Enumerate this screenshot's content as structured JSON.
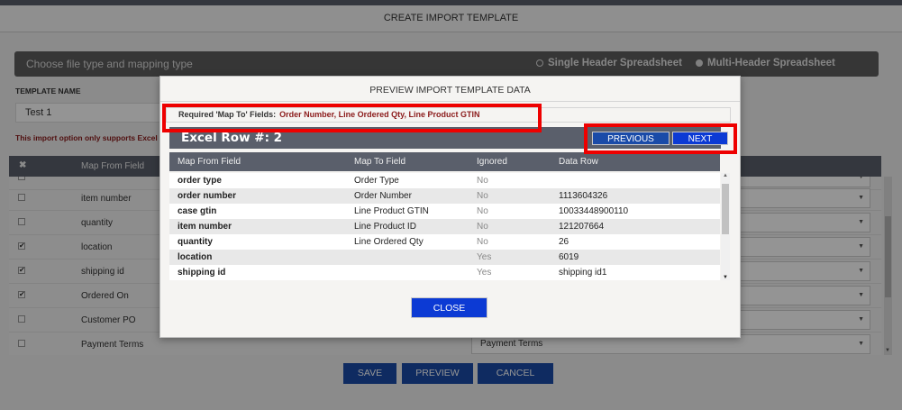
{
  "page": {
    "title": "CREATE IMPORT TEMPLATE",
    "file_type_label": "Choose file type and mapping type",
    "option_single": "Single Header Spreadsheet",
    "option_multi": "Multi-Header Spreadsheet",
    "template_name_label": "TEMPLATE NAME",
    "template_name_value": "Test 1",
    "warning": "This import option only supports Excel",
    "map_header_x": "✖",
    "map_header_from": "Map From Field",
    "rows": [
      {
        "checked": "",
        "field": "item number",
        "select": ""
      },
      {
        "checked": "",
        "field": "quantity",
        "select": ""
      },
      {
        "checked": "✔",
        "field": "location",
        "select": ""
      },
      {
        "checked": "✔",
        "field": "shipping id",
        "select": ""
      },
      {
        "checked": "✔",
        "field": "Ordered On",
        "select": ""
      },
      {
        "checked": "",
        "field": "Customer PO",
        "select": ""
      },
      {
        "checked": "",
        "field": "Payment Terms",
        "select": "Payment Terms"
      }
    ],
    "buttons": {
      "save": "SAVE",
      "preview": "PREVIEW",
      "cancel": "CANCEL"
    }
  },
  "modal": {
    "title": "PREVIEW IMPORT TEMPLATE DATA",
    "required_label": "Required 'Map To' Fields:",
    "required_value": "Order Number, Line Ordered Qty, Line Product GTIN",
    "excel_row_label": "Excel Row #: 2",
    "previous_label": "PREVIOUS",
    "next_label": "NEXT",
    "columns": [
      "Map From Field",
      "Map To Field",
      "Ignored",
      "Data Row"
    ],
    "rows": [
      [
        "order type",
        "Order Type",
        "No",
        ""
      ],
      [
        "order number",
        "Order Number",
        "No",
        "1113604326"
      ],
      [
        "case gtin",
        "Line Product GTIN",
        "No",
        "10033448900110"
      ],
      [
        "item number",
        "Line Product ID",
        "No",
        "121207664"
      ],
      [
        "quantity",
        "Line Ordered Qty",
        "No",
        "26"
      ],
      [
        "location",
        "",
        "Yes",
        "6019"
      ],
      [
        "shipping id",
        "",
        "Yes",
        "shipping id1"
      ]
    ],
    "close_label": "CLOSE"
  },
  "colors": {
    "header_gray": "#5a5f6b",
    "button_blue": "#1a4ba8",
    "active_blue": "#0c3ad4",
    "required_red": "#8b1a1a",
    "highlight_red": "#ee0000"
  }
}
